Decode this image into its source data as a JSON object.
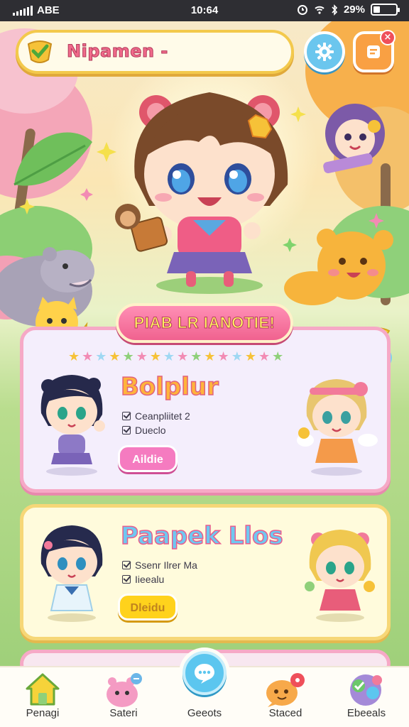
{
  "status_bar": {
    "carrier": "ABE",
    "time": "10:64",
    "battery": "29%",
    "battery_level": 0.29
  },
  "header": {
    "title": "Nipamen -",
    "settings_icon": "gear-icon",
    "menu_icon": "menu-icon",
    "close_icon": "close-icon"
  },
  "panel1": {
    "banner": "PIAB LR IANOTIE!",
    "title": "Bolplur",
    "checks": [
      "Ceanpliitet 2",
      "Dueclo"
    ],
    "button": "Aildie"
  },
  "panel2": {
    "title": "Paapek Llos",
    "checks": [
      "Ssenr Ilrer Ma",
      "Iieealu"
    ],
    "button": "Dleidu"
  },
  "bottom_nav": {
    "items": [
      {
        "label": "Penagi",
        "icon": "home-icon"
      },
      {
        "label": "Sateri",
        "icon": "pet-icon"
      },
      {
        "label": "Geeots",
        "icon": "chat-icon"
      },
      {
        "label": "Staced",
        "icon": "messages-icon"
      },
      {
        "label": "Ebeeals",
        "icon": "collection-icon"
      }
    ]
  },
  "colors": {
    "accent_pink": "#f0628f",
    "accent_yellow": "#ffd21c",
    "accent_blue": "#5cc6ef"
  }
}
